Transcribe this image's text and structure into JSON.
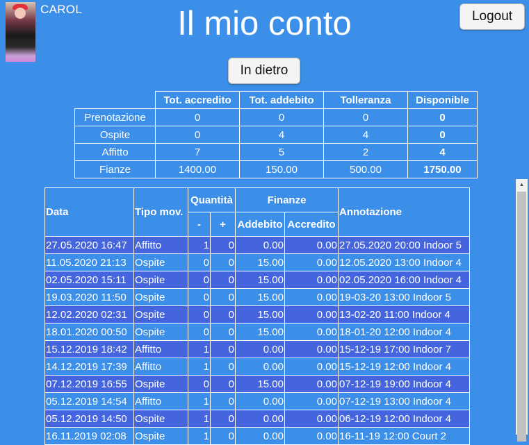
{
  "header": {
    "username": "CAROL",
    "title": "Il mio conto",
    "logout_label": "Logout",
    "back_label": "In dietro"
  },
  "summary": {
    "columns": [
      "Tot. accredito",
      "Tot. addebito",
      "Tolleranza",
      "Disponible"
    ],
    "rows": [
      {
        "label": "Prenotazione",
        "values": [
          "0",
          "0",
          "0",
          "0"
        ]
      },
      {
        "label": "Ospite",
        "values": [
          "0",
          "4",
          "4",
          "0"
        ]
      },
      {
        "label": "Affitto",
        "values": [
          "7",
          "5",
          "2",
          "4"
        ]
      },
      {
        "label": "Fianze",
        "values": [
          "1400.00",
          "150.00",
          "500.00",
          "1750.00"
        ]
      }
    ]
  },
  "movements": {
    "headers": {
      "data": "Data",
      "tipo": "Tipo mov.",
      "quantita": "Quantità",
      "minus": "-",
      "plus": "+",
      "finanze": "Finanze",
      "addebito": "Addebito",
      "accredito": "Accredito",
      "annotazione": "Annotazione"
    },
    "rows": [
      {
        "data": "27.05.2020 16:47",
        "tipo": "Affitto",
        "minus": "1",
        "plus": "0",
        "addebito": "0.00",
        "accredito": "0.00",
        "annotazione": "27.05.2020 20:00 Indoor 5"
      },
      {
        "data": "11.05.2020 21:13",
        "tipo": "Ospite",
        "minus": "0",
        "plus": "0",
        "addebito": "15.00",
        "accredito": "0.00",
        "annotazione": "12.05.2020 13:00 Indoor 4"
      },
      {
        "data": "02.05.2020 15:11",
        "tipo": "Ospite",
        "minus": "0",
        "plus": "0",
        "addebito": "15.00",
        "accredito": "0.00",
        "annotazione": "02.05.2020 16:00 Indoor 4"
      },
      {
        "data": "19.03.2020 11:50",
        "tipo": "Ospite",
        "minus": "0",
        "plus": "0",
        "addebito": "15.00",
        "accredito": "0.00",
        "annotazione": "19-03-20 13:00 Indoor 5"
      },
      {
        "data": "12.02.2020 02:31",
        "tipo": "Ospite",
        "minus": "0",
        "plus": "0",
        "addebito": "15.00",
        "accredito": "0.00",
        "annotazione": "13-02-20 11:00 Indoor 4"
      },
      {
        "data": "18.01.2020 00:50",
        "tipo": "Ospite",
        "minus": "0",
        "plus": "0",
        "addebito": "15.00",
        "accredito": "0.00",
        "annotazione": "18-01-20 12:00 Indoor 4"
      },
      {
        "data": "15.12.2019 18:42",
        "tipo": "Affitto",
        "minus": "1",
        "plus": "0",
        "addebito": "0.00",
        "accredito": "0.00",
        "annotazione": "15-12-19 17:00 Indoor 7"
      },
      {
        "data": "14.12.2019 17:39",
        "tipo": "Affitto",
        "minus": "1",
        "plus": "0",
        "addebito": "0.00",
        "accredito": "0.00",
        "annotazione": "15-12-19 12:00 Indoor 4"
      },
      {
        "data": "07.12.2019 16:55",
        "tipo": "Ospite",
        "minus": "0",
        "plus": "0",
        "addebito": "15.00",
        "accredito": "0.00",
        "annotazione": "07-12-19 19:00 Indoor 4"
      },
      {
        "data": "05.12.2019 14:54",
        "tipo": "Affitto",
        "minus": "1",
        "plus": "0",
        "addebito": "0.00",
        "accredito": "0.00",
        "annotazione": "07-12-19 13:00 Indoor 4"
      },
      {
        "data": "05.12.2019 14:50",
        "tipo": "Ospite",
        "minus": "1",
        "plus": "0",
        "addebito": "0.00",
        "accredito": "0.00",
        "annotazione": "06-12-19 12:00 Indoor 4"
      },
      {
        "data": "16.11.2019 02:08",
        "tipo": "Ospite",
        "minus": "1",
        "plus": "0",
        "addebito": "0.00",
        "accredito": "0.00",
        "annotazione": "16-11-19 12:00 Court 2"
      }
    ]
  },
  "colors": {
    "background": "#3b8fe8",
    "row_highlight": "#4565de"
  }
}
